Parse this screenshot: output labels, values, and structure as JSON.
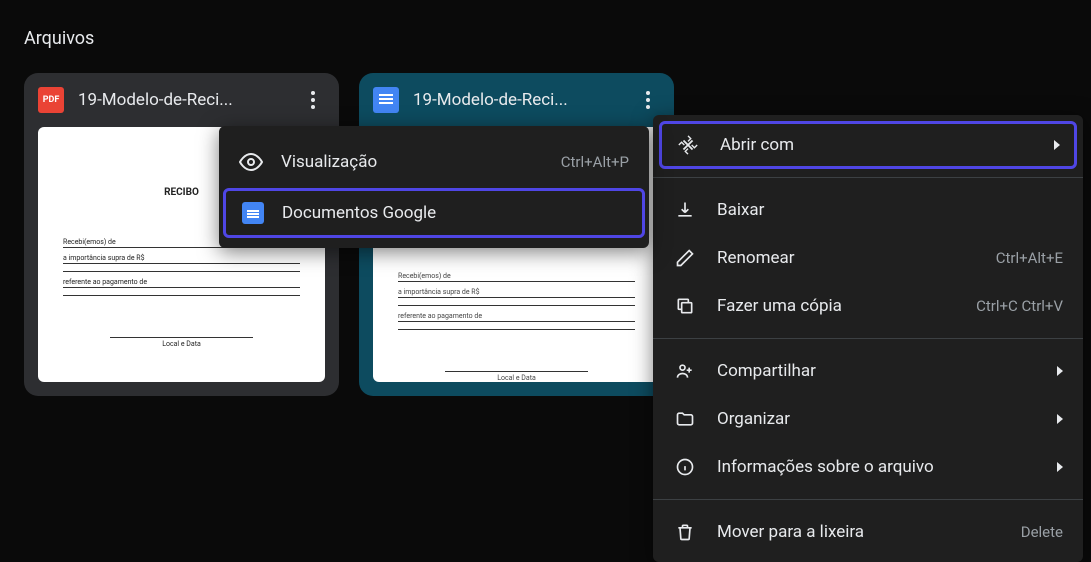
{
  "section_title": "Arquivos",
  "files": [
    {
      "name": "19-Modelo-de-Reci...",
      "type": "pdf"
    },
    {
      "name": "19-Modelo-de-Reci...",
      "type": "docs"
    }
  ],
  "thumbnail": {
    "title": "RECIBO",
    "footer": "Local e Data"
  },
  "submenu": {
    "preview": {
      "label": "Visualização",
      "shortcut": "Ctrl+Alt+P"
    },
    "google_docs": {
      "label": "Documentos Google"
    }
  },
  "context_menu": {
    "open_with": {
      "label": "Abrir com"
    },
    "download": {
      "label": "Baixar"
    },
    "rename": {
      "label": "Renomear",
      "shortcut": "Ctrl+Alt+E"
    },
    "copy": {
      "label": "Fazer uma cópia",
      "shortcut": "Ctrl+C Ctrl+V"
    },
    "share": {
      "label": "Compartilhar"
    },
    "organize": {
      "label": "Organizar"
    },
    "info": {
      "label": "Informações sobre o arquivo"
    },
    "trash": {
      "label": "Mover para a lixeira",
      "shortcut": "Delete"
    }
  }
}
